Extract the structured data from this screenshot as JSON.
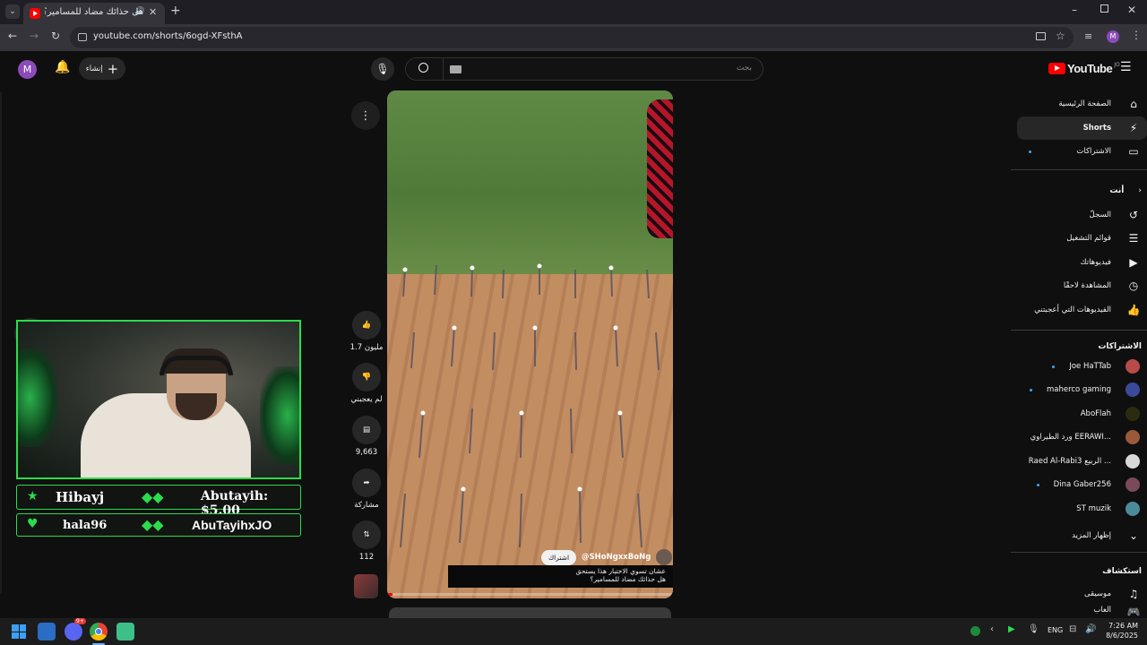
{
  "browser": {
    "tab_title": "هل حذائك مضاد للمسامير؟ -",
    "url": "youtube.com/shorts/6ogd-XFsthA",
    "profile_initial": "M"
  },
  "header": {
    "create_label": "إنشاء",
    "search_placeholder": "بحث",
    "logo_text": "YouTube",
    "logo_region": "JO",
    "user_initial": "M"
  },
  "sidebar": {
    "main": [
      {
        "label": "الصفحة الرئيسية",
        "icon": "home-icon"
      },
      {
        "label": "Shorts",
        "icon": "shorts-icon"
      },
      {
        "label": "الاشتراكات",
        "icon": "subscriptions-icon"
      }
    ],
    "you_header": "أنت",
    "you": [
      {
        "label": "السجلّ",
        "icon": "history-icon"
      },
      {
        "label": "قوائم التشغيل",
        "icon": "playlists-icon"
      },
      {
        "label": "فيديوهاتك",
        "icon": "your-videos-icon"
      },
      {
        "label": "المشاهدة لاحقًا",
        "icon": "watch-later-icon"
      },
      {
        "label": "الفيديوهات التي أعجبتني",
        "icon": "liked-icon"
      }
    ],
    "subs_header": "الاشتراكات",
    "subscriptions": [
      {
        "name": "Joe HaTTab",
        "color": "#b84a4a",
        "dot": true
      },
      {
        "name": "maherco gaming",
        "color": "#3a4a9a",
        "dot": true
      },
      {
        "name": "AboFlah",
        "color": "#2b2b10",
        "dot": false
      },
      {
        "name": "ورد الطيراوي EERAWI...",
        "color": "#9a5a3a",
        "dot": false
      },
      {
        "name": "Raed Al-Rabi3 الربيع ...",
        "color": "#d8d8d8",
        "dot": false
      },
      {
        "name": "Dina Gaber256",
        "color": "#7a4a5a",
        "dot": true
      },
      {
        "name": "ST muzik",
        "color": "#4a8a9a",
        "dot": false
      }
    ],
    "show_more": "إظهار المزيد",
    "explore_header": "استكشاف",
    "explore": [
      {
        "label": "موسيقى",
        "icon": "music-icon"
      },
      {
        "label": "ألعاب",
        "icon": "gaming-icon"
      }
    ]
  },
  "short": {
    "likes": "1.7 مليون",
    "dislike_label": "لم يعجبني",
    "comments": "9,663",
    "share_label": "مشاركة",
    "remix_count": "112",
    "channel": "@SHoNgxxBoNg",
    "subscribe_label": "اشتراك",
    "caption_line1": "هل حذائك مضاد للمسامير؟",
    "caption_line2": "عشان تسوي الاختبار هذا يستحق",
    "progress": 0.02
  },
  "overlay": {
    "row1_left": "Hibayj",
    "row1_right": "Abutayih: $5.00",
    "row2_left": "hala96",
    "row2_right": "AbuTayihxJO"
  },
  "taskbar": {
    "lang": "ENG",
    "time": "7:26 AM",
    "date": "8/6/2025",
    "discord_badge": "9+"
  }
}
